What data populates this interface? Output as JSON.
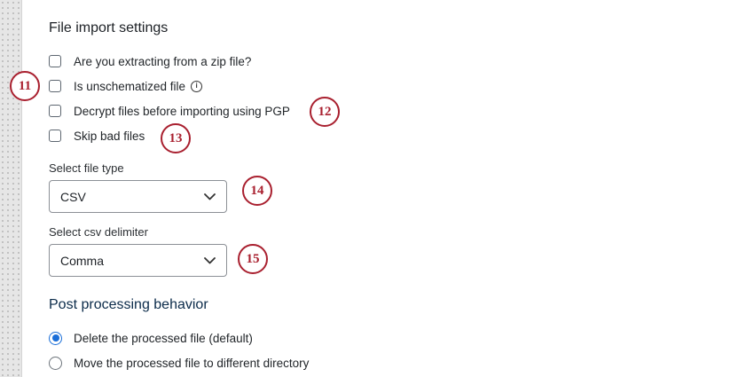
{
  "file_import_settings": {
    "title": "File import settings",
    "options": [
      {
        "label": "Are you extracting from a zip file?",
        "checked": false
      },
      {
        "label": "Is unschematized file",
        "checked": false,
        "info_icon": "info-icon"
      },
      {
        "label": "Decrypt files before importing using PGP",
        "checked": false
      },
      {
        "label": "Skip bad files",
        "checked": false
      }
    ]
  },
  "file_type": {
    "label": "Select file type",
    "value": "CSV"
  },
  "csv_delimiter": {
    "label": "Select csv delimiter",
    "value": "Comma"
  },
  "post_processing": {
    "title": "Post processing behavior",
    "options": [
      {
        "label": "Delete the processed file (default)",
        "selected": true
      },
      {
        "label": "Move the processed file to different directory",
        "selected": false
      }
    ]
  },
  "callouts": [
    "11",
    "12",
    "13",
    "14",
    "15"
  ],
  "colors": {
    "callout": "#a9202f",
    "radio_selected": "#1a6ed8",
    "section_title_blue": "#0b2b4a"
  }
}
